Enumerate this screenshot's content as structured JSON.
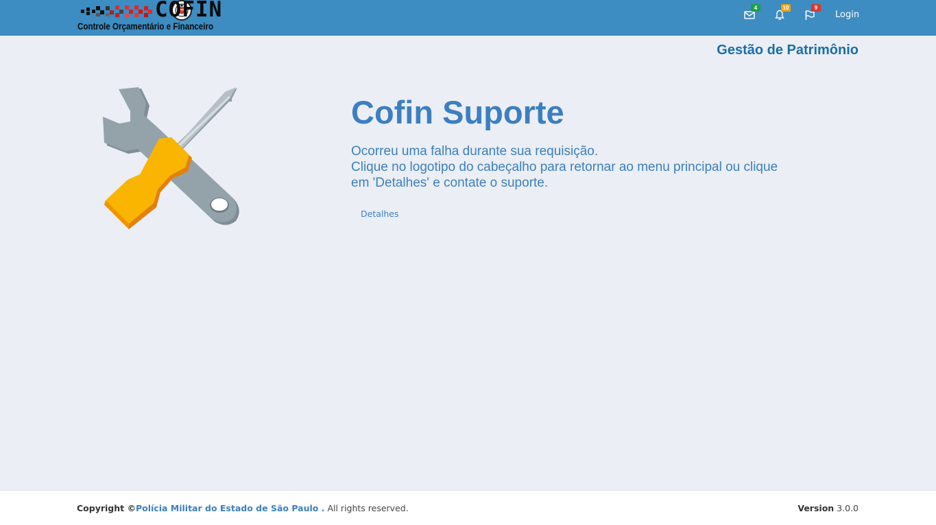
{
  "header": {
    "logo_name": "COFIN",
    "logo_subtitle": "Controle Orçamentário e Financeiro",
    "notifications": [
      {
        "icon": "envelope-icon",
        "count": "4",
        "color": "#1e9e4a"
      },
      {
        "icon": "bell-icon",
        "count": "10",
        "color": "#f0a30a"
      },
      {
        "icon": "flag-icon",
        "count": "9",
        "color": "#d9382f"
      }
    ],
    "login_label": "Login",
    "bar_color": "#3d8cc2"
  },
  "module_title": "Gestão de Patrimônio",
  "main": {
    "illustration": "wrench-screwdriver-icon",
    "title": "Cofin Suporte",
    "message_lines": [
      "Ocorreu uma falha durante sua requisição.",
      "Clique no logotipo do cabeçalho para retornar ao menu principal ou clique",
      "em 'Detalhes' e contate o suporte."
    ],
    "details_link": "Detalhes"
  },
  "footer": {
    "copyright_prefix": "Copyright ©",
    "organization": "Polícia Militar do Estado de São Paulo .",
    "rights": "All rights reserved.",
    "version_label": "Version",
    "version_value": "3.0.0"
  }
}
